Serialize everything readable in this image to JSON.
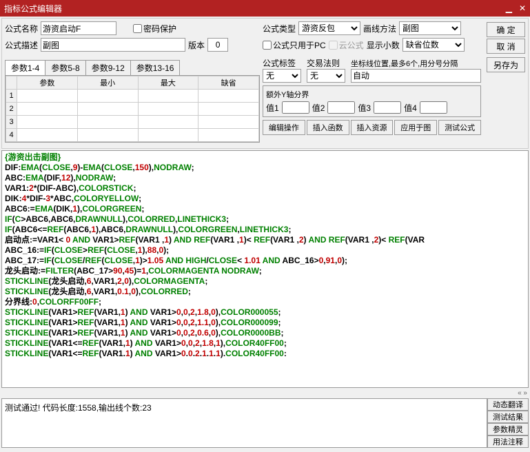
{
  "title": "指标公式编辑器",
  "labels": {
    "name": "公式名称",
    "desc": "公式描述",
    "passwordProtect": "密码保护",
    "version": "版本",
    "type": "公式类型",
    "drawMethod": "画线方法",
    "pcOnly": "公式只用于PC",
    "cloud": "云公式",
    "showDecimal": "显示小数",
    "tag": "公式标签",
    "tradeRule": "交易法则",
    "axisPos": "坐标线位置,最多6个,用分号分隔",
    "extraY": "额外Y轴分界",
    "v1": "值1",
    "v2": "值2",
    "v3": "值3",
    "v4": "值4"
  },
  "values": {
    "name": "游资启动F",
    "desc": "副图",
    "version": "0",
    "type": "游资反包",
    "drawMethod": "副图",
    "showDecimal": "缺省位数",
    "tag": "无",
    "tradeRule": "无",
    "axisPos": "自动"
  },
  "buttons": {
    "ok": "确 定",
    "cancel": "取 消",
    "saveAs": "另存为",
    "editOp": "编辑操作",
    "insertFn": "插入函数",
    "insertRes": "插入资源",
    "applyChart": "应用于图",
    "testFormula": "测试公式",
    "dynTrans": "动态翻译",
    "testResult": "测试结果",
    "paramWizard": "参数精灵",
    "usageNote": "用法注释"
  },
  "paramTabs": [
    "参数1-4",
    "参数5-8",
    "参数9-12",
    "参数13-16"
  ],
  "paramHeaders": [
    "参数",
    "最小",
    "最大",
    "缺省"
  ],
  "paramRows": [
    "1",
    "2",
    "3",
    "4"
  ],
  "message": "测试通过! 代码长度:1558,输出线个数:23",
  "scrollIndicator": "«  »",
  "code": [
    [
      {
        "t": "{游资出击副图}",
        "c": "green"
      }
    ],
    [
      {
        "t": "DIF:",
        "c": "black"
      },
      {
        "t": "EMA",
        "c": "green"
      },
      {
        "t": "(",
        "c": "black"
      },
      {
        "t": "CLOSE",
        "c": "green"
      },
      {
        "t": ",",
        "c": "black"
      },
      {
        "t": "9",
        "c": "red"
      },
      {
        "t": ")-",
        "c": "black"
      },
      {
        "t": "EMA",
        "c": "green"
      },
      {
        "t": "(",
        "c": "black"
      },
      {
        "t": "CLOSE",
        "c": "green"
      },
      {
        "t": ",",
        "c": "black"
      },
      {
        "t": "150",
        "c": "red"
      },
      {
        "t": "),",
        "c": "black"
      },
      {
        "t": "NODRAW",
        "c": "green"
      },
      {
        "t": ";",
        "c": "black"
      }
    ],
    [
      {
        "t": "ABC:",
        "c": "black"
      },
      {
        "t": "EMA",
        "c": "green"
      },
      {
        "t": "(",
        "c": "black"
      },
      {
        "t": "DIF",
        "c": "black"
      },
      {
        "t": ",",
        "c": "black"
      },
      {
        "t": "12",
        "c": "red"
      },
      {
        "t": "),",
        "c": "black"
      },
      {
        "t": "NODRAW",
        "c": "green"
      },
      {
        "t": ";",
        "c": "black"
      }
    ],
    [
      {
        "t": "VAR1:",
        "c": "black"
      },
      {
        "t": "2",
        "c": "red"
      },
      {
        "t": "*(DIF-ABC),",
        "c": "black"
      },
      {
        "t": "COLORSTICK",
        "c": "green"
      },
      {
        "t": ";",
        "c": "black"
      }
    ],
    [
      {
        "t": "DIK:",
        "c": "black"
      },
      {
        "t": "4",
        "c": "red"
      },
      {
        "t": "*DIF-",
        "c": "black"
      },
      {
        "t": "3",
        "c": "red"
      },
      {
        "t": "*ABC,",
        "c": "black"
      },
      {
        "t": "COLORYELLOW",
        "c": "green"
      },
      {
        "t": ";",
        "c": "black"
      }
    ],
    [
      {
        "t": "ABC6:=",
        "c": "black"
      },
      {
        "t": "EMA",
        "c": "green"
      },
      {
        "t": "(DIK,",
        "c": "black"
      },
      {
        "t": "1",
        "c": "red"
      },
      {
        "t": "),",
        "c": "black"
      },
      {
        "t": "COLORGREEN",
        "c": "green"
      },
      {
        "t": ";",
        "c": "black"
      }
    ],
    [
      {
        "t": "IF",
        "c": "green"
      },
      {
        "t": "(",
        "c": "black"
      },
      {
        "t": "C",
        "c": "green"
      },
      {
        "t": ">ABC6,ABC6,",
        "c": "black"
      },
      {
        "t": "DRAWNULL",
        "c": "green"
      },
      {
        "t": "),",
        "c": "black"
      },
      {
        "t": "COLORRED",
        "c": "green"
      },
      {
        "t": ",",
        "c": "black"
      },
      {
        "t": "LINETHICK3",
        "c": "green"
      },
      {
        "t": ";",
        "c": "black"
      }
    ],
    [
      {
        "t": "IF",
        "c": "green"
      },
      {
        "t": "(ABC6<=",
        "c": "black"
      },
      {
        "t": "REF",
        "c": "green"
      },
      {
        "t": "(ABC6,",
        "c": "black"
      },
      {
        "t": "1",
        "c": "red"
      },
      {
        "t": "),ABC6,",
        "c": "black"
      },
      {
        "t": "DRAWNULL",
        "c": "green"
      },
      {
        "t": "),",
        "c": "black"
      },
      {
        "t": "COLORGREEN",
        "c": "green"
      },
      {
        "t": ",",
        "c": "black"
      },
      {
        "t": "LINETHICK3",
        "c": "green"
      },
      {
        "t": ";",
        "c": "black"
      }
    ],
    [
      {
        "t": "启动点:=VAR1< ",
        "c": "black"
      },
      {
        "t": "0",
        "c": "red"
      },
      {
        "t": " ",
        "c": "black"
      },
      {
        "t": "AND",
        "c": "green"
      },
      {
        "t": " VAR1>",
        "c": "black"
      },
      {
        "t": "REF",
        "c": "green"
      },
      {
        "t": "(VAR1 ,",
        "c": "black"
      },
      {
        "t": "1",
        "c": "red"
      },
      {
        "t": ") ",
        "c": "black"
      },
      {
        "t": "AND",
        "c": "green"
      },
      {
        "t": " ",
        "c": "black"
      },
      {
        "t": "REF",
        "c": "green"
      },
      {
        "t": "(VAR1 ,",
        "c": "black"
      },
      {
        "t": "1",
        "c": "red"
      },
      {
        "t": ")< ",
        "c": "black"
      },
      {
        "t": "REF",
        "c": "green"
      },
      {
        "t": "(VAR1 ,",
        "c": "black"
      },
      {
        "t": "2",
        "c": "red"
      },
      {
        "t": ") ",
        "c": "black"
      },
      {
        "t": "AND",
        "c": "green"
      },
      {
        "t": " ",
        "c": "black"
      },
      {
        "t": "REF",
        "c": "green"
      },
      {
        "t": "(VAR1 ,",
        "c": "black"
      },
      {
        "t": "2",
        "c": "red"
      },
      {
        "t": ")< ",
        "c": "black"
      },
      {
        "t": "REF",
        "c": "green"
      },
      {
        "t": "(VAR",
        "c": "black"
      }
    ],
    [
      {
        "t": "ABC_16:=",
        "c": "black"
      },
      {
        "t": "IF",
        "c": "green"
      },
      {
        "t": "(",
        "c": "black"
      },
      {
        "t": "CLOSE",
        "c": "green"
      },
      {
        "t": ">",
        "c": "black"
      },
      {
        "t": "REF",
        "c": "green"
      },
      {
        "t": "(",
        "c": "black"
      },
      {
        "t": "CLOSE",
        "c": "green"
      },
      {
        "t": ",",
        "c": "black"
      },
      {
        "t": "1",
        "c": "red"
      },
      {
        "t": "),",
        "c": "black"
      },
      {
        "t": "88",
        "c": "red"
      },
      {
        "t": ",",
        "c": "black"
      },
      {
        "t": "0",
        "c": "red"
      },
      {
        "t": ");",
        "c": "black"
      }
    ],
    [
      {
        "t": "ABC_17:=",
        "c": "black"
      },
      {
        "t": "IF",
        "c": "green"
      },
      {
        "t": "(",
        "c": "black"
      },
      {
        "t": "CLOSE",
        "c": "green"
      },
      {
        "t": "/",
        "c": "black"
      },
      {
        "t": "REF",
        "c": "green"
      },
      {
        "t": "(",
        "c": "black"
      },
      {
        "t": "CLOSE",
        "c": "green"
      },
      {
        "t": ",",
        "c": "black"
      },
      {
        "t": "1",
        "c": "red"
      },
      {
        "t": ")>",
        "c": "black"
      },
      {
        "t": "1.05",
        "c": "red"
      },
      {
        "t": " ",
        "c": "black"
      },
      {
        "t": "AND",
        "c": "green"
      },
      {
        "t": " ",
        "c": "black"
      },
      {
        "t": "HIGH",
        "c": "green"
      },
      {
        "t": "/",
        "c": "black"
      },
      {
        "t": "CLOSE",
        "c": "green"
      },
      {
        "t": "< ",
        "c": "black"
      },
      {
        "t": "1.01",
        "c": "red"
      },
      {
        "t": " ",
        "c": "black"
      },
      {
        "t": "AND",
        "c": "green"
      },
      {
        "t": " ABC_16>",
        "c": "black"
      },
      {
        "t": "0",
        "c": "red"
      },
      {
        "t": ",",
        "c": "black"
      },
      {
        "t": "91",
        "c": "red"
      },
      {
        "t": ",",
        "c": "black"
      },
      {
        "t": "0",
        "c": "red"
      },
      {
        "t": ");",
        "c": "black"
      }
    ],
    [
      {
        "t": "龙头启动:=",
        "c": "black"
      },
      {
        "t": "FILTER",
        "c": "green"
      },
      {
        "t": "(ABC_17>",
        "c": "black"
      },
      {
        "t": "90",
        "c": "red"
      },
      {
        "t": ",",
        "c": "black"
      },
      {
        "t": "45",
        "c": "red"
      },
      {
        "t": ")=",
        "c": "black"
      },
      {
        "t": "1",
        "c": "red"
      },
      {
        "t": ",",
        "c": "black"
      },
      {
        "t": "COLORMAGENTA",
        "c": "green"
      },
      {
        "t": " ",
        "c": "black"
      },
      {
        "t": "NODRAW",
        "c": "green"
      },
      {
        "t": ";",
        "c": "black"
      }
    ],
    [
      {
        "t": "STICKLINE",
        "c": "green"
      },
      {
        "t": "(龙头启动,",
        "c": "black"
      },
      {
        "t": "6",
        "c": "red"
      },
      {
        "t": ",VAR1,",
        "c": "black"
      },
      {
        "t": "2",
        "c": "red"
      },
      {
        "t": ",",
        "c": "black"
      },
      {
        "t": "0",
        "c": "red"
      },
      {
        "t": "),",
        "c": "black"
      },
      {
        "t": "COLORMAGENTA",
        "c": "green"
      },
      {
        "t": ";",
        "c": "black"
      }
    ],
    [
      {
        "t": "STICKLINE",
        "c": "green"
      },
      {
        "t": "(龙头启动,",
        "c": "black"
      },
      {
        "t": "6",
        "c": "red"
      },
      {
        "t": ",VAR1,",
        "c": "black"
      },
      {
        "t": "0.1",
        "c": "red"
      },
      {
        "t": ",",
        "c": "black"
      },
      {
        "t": "0",
        "c": "red"
      },
      {
        "t": "),",
        "c": "black"
      },
      {
        "t": "COLORRED",
        "c": "green"
      },
      {
        "t": ";",
        "c": "black"
      }
    ],
    [
      {
        "t": "分界线:",
        "c": "black"
      },
      {
        "t": "0",
        "c": "red"
      },
      {
        "t": ",",
        "c": "black"
      },
      {
        "t": "COLORFF00FF",
        "c": "green"
      },
      {
        "t": ";",
        "c": "black"
      }
    ],
    [
      {
        "t": "STICKLINE",
        "c": "green"
      },
      {
        "t": "(VAR1>",
        "c": "black"
      },
      {
        "t": "REF",
        "c": "green"
      },
      {
        "t": "(VAR1,",
        "c": "black"
      },
      {
        "t": "1",
        "c": "red"
      },
      {
        "t": ") ",
        "c": "black"
      },
      {
        "t": "AND",
        "c": "green"
      },
      {
        "t": " VAR1>",
        "c": "black"
      },
      {
        "t": "0",
        "c": "red"
      },
      {
        "t": ",",
        "c": "black"
      },
      {
        "t": "0",
        "c": "red"
      },
      {
        "t": ",",
        "c": "black"
      },
      {
        "t": "2",
        "c": "red"
      },
      {
        "t": ",",
        "c": "black"
      },
      {
        "t": "1.8",
        "c": "red"
      },
      {
        "t": ",",
        "c": "black"
      },
      {
        "t": "0",
        "c": "red"
      },
      {
        "t": "),",
        "c": "black"
      },
      {
        "t": "COLOR000055",
        "c": "green"
      },
      {
        "t": ";",
        "c": "black"
      }
    ],
    [
      {
        "t": "STICKLINE",
        "c": "green"
      },
      {
        "t": "(VAR1>",
        "c": "black"
      },
      {
        "t": "REF",
        "c": "green"
      },
      {
        "t": "(VAR1,",
        "c": "black"
      },
      {
        "t": "1",
        "c": "red"
      },
      {
        "t": ") ",
        "c": "black"
      },
      {
        "t": "AND",
        "c": "green"
      },
      {
        "t": " VAR1>",
        "c": "black"
      },
      {
        "t": "0",
        "c": "red"
      },
      {
        "t": ",",
        "c": "black"
      },
      {
        "t": "0",
        "c": "red"
      },
      {
        "t": ",",
        "c": "black"
      },
      {
        "t": "2",
        "c": "red"
      },
      {
        "t": ",",
        "c": "black"
      },
      {
        "t": "1.1",
        "c": "red"
      },
      {
        "t": ",",
        "c": "black"
      },
      {
        "t": "0",
        "c": "red"
      },
      {
        "t": "),",
        "c": "black"
      },
      {
        "t": "COLOR000099",
        "c": "green"
      },
      {
        "t": ";",
        "c": "black"
      }
    ],
    [
      {
        "t": "STICKLINE",
        "c": "green"
      },
      {
        "t": "(VAR1>",
        "c": "black"
      },
      {
        "t": "REF",
        "c": "green"
      },
      {
        "t": "(VAR1,",
        "c": "black"
      },
      {
        "t": "1",
        "c": "red"
      },
      {
        "t": ") ",
        "c": "black"
      },
      {
        "t": "AND",
        "c": "green"
      },
      {
        "t": " VAR1>",
        "c": "black"
      },
      {
        "t": "0",
        "c": "red"
      },
      {
        "t": ",",
        "c": "black"
      },
      {
        "t": "0",
        "c": "red"
      },
      {
        "t": ",",
        "c": "black"
      },
      {
        "t": "2",
        "c": "red"
      },
      {
        "t": ",",
        "c": "black"
      },
      {
        "t": "0.6",
        "c": "red"
      },
      {
        "t": ",",
        "c": "black"
      },
      {
        "t": "0",
        "c": "red"
      },
      {
        "t": "),",
        "c": "black"
      },
      {
        "t": "COLOR0000BB",
        "c": "green"
      },
      {
        "t": ";",
        "c": "black"
      }
    ],
    [
      {
        "t": "STICKLINE",
        "c": "green"
      },
      {
        "t": "(VAR1<=",
        "c": "black"
      },
      {
        "t": "REF",
        "c": "green"
      },
      {
        "t": "(VAR1,",
        "c": "black"
      },
      {
        "t": "1",
        "c": "red"
      },
      {
        "t": ") ",
        "c": "black"
      },
      {
        "t": "AND",
        "c": "green"
      },
      {
        "t": " VAR1>",
        "c": "black"
      },
      {
        "t": "0",
        "c": "red"
      },
      {
        "t": ",",
        "c": "black"
      },
      {
        "t": "0",
        "c": "red"
      },
      {
        "t": ",",
        "c": "black"
      },
      {
        "t": "2",
        "c": "red"
      },
      {
        "t": ",",
        "c": "black"
      },
      {
        "t": "1.8",
        "c": "red"
      },
      {
        "t": ",",
        "c": "black"
      },
      {
        "t": "1",
        "c": "red"
      },
      {
        "t": "),",
        "c": "black"
      },
      {
        "t": "COLOR40FF00",
        "c": "green"
      },
      {
        "t": ";",
        "c": "black"
      }
    ],
    [
      {
        "t": "STICKLINE",
        "c": "green"
      },
      {
        "t": "(VAR1<=",
        "c": "black"
      },
      {
        "t": "REF",
        "c": "green"
      },
      {
        "t": "(VAR1.",
        "c": "black"
      },
      {
        "t": "1",
        "c": "red"
      },
      {
        "t": ") ",
        "c": "black"
      },
      {
        "t": "AND",
        "c": "green"
      },
      {
        "t": " VAR1>",
        "c": "black"
      },
      {
        "t": "0",
        "c": "red"
      },
      {
        "t": ".",
        "c": "black"
      },
      {
        "t": "0",
        "c": "red"
      },
      {
        "t": ".",
        "c": "black"
      },
      {
        "t": "2",
        "c": "red"
      },
      {
        "t": ".",
        "c": "black"
      },
      {
        "t": "1",
        "c": "red"
      },
      {
        "t": ".",
        "c": "black"
      },
      {
        "t": "1",
        "c": "red"
      },
      {
        "t": ".",
        "c": "black"
      },
      {
        "t": "1",
        "c": "red"
      },
      {
        "t": ").",
        "c": "black"
      },
      {
        "t": "COLOR40FF00",
        "c": "green"
      },
      {
        "t": ":",
        "c": "black"
      }
    ]
  ]
}
